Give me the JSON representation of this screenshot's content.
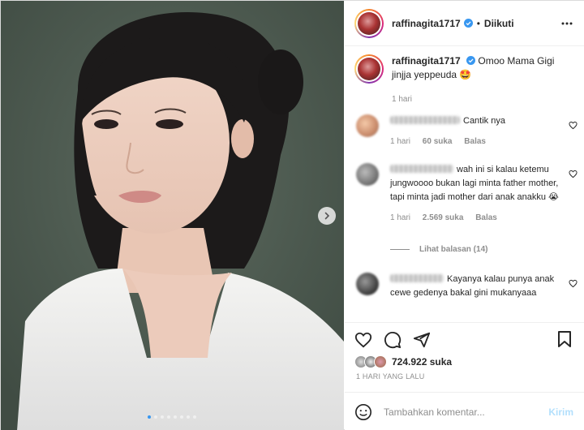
{
  "post": {
    "username": "raffinagita1717",
    "follow_status": "Diikuti",
    "caption_text": "Omoo Mama Gigi jinjja yeppeuda 🤩",
    "caption_time": "1 hari",
    "likes": "724.922 suka",
    "posted_ago": "1 HARI YANG LALU",
    "carousel_total": 8,
    "carousel_active": 1
  },
  "comments": [
    {
      "text": "Cantik nya",
      "time": "1 hari",
      "likes": "60 suka",
      "reply": "Balas"
    },
    {
      "text": "wah ini si kalau ketemu jungwoooo bukan lagi minta father mother, tapi minta jadi mother dari anak anakku 😭",
      "time": "1 hari",
      "likes": "2.569 suka",
      "reply": "Balas"
    },
    {
      "text": "Kayanya kalau punya anak cewe gedenya bakal gini mukanyaaa"
    }
  ],
  "view_replies": "Lihat balasan (14)",
  "comment_box": {
    "placeholder": "Tambahkan komentar...",
    "post_label": "Kirim"
  },
  "colors": {
    "accent": "#0095f6",
    "post_disabled": "#b2dffc",
    "muted": "#8e8e8e",
    "photo_bg": "#4c5a4f"
  },
  "icons": [
    "verified-badge-icon",
    "more-options-icon",
    "chevron-right-icon",
    "heart-icon",
    "comment-icon",
    "share-icon",
    "bookmark-icon",
    "emoji-icon"
  ]
}
